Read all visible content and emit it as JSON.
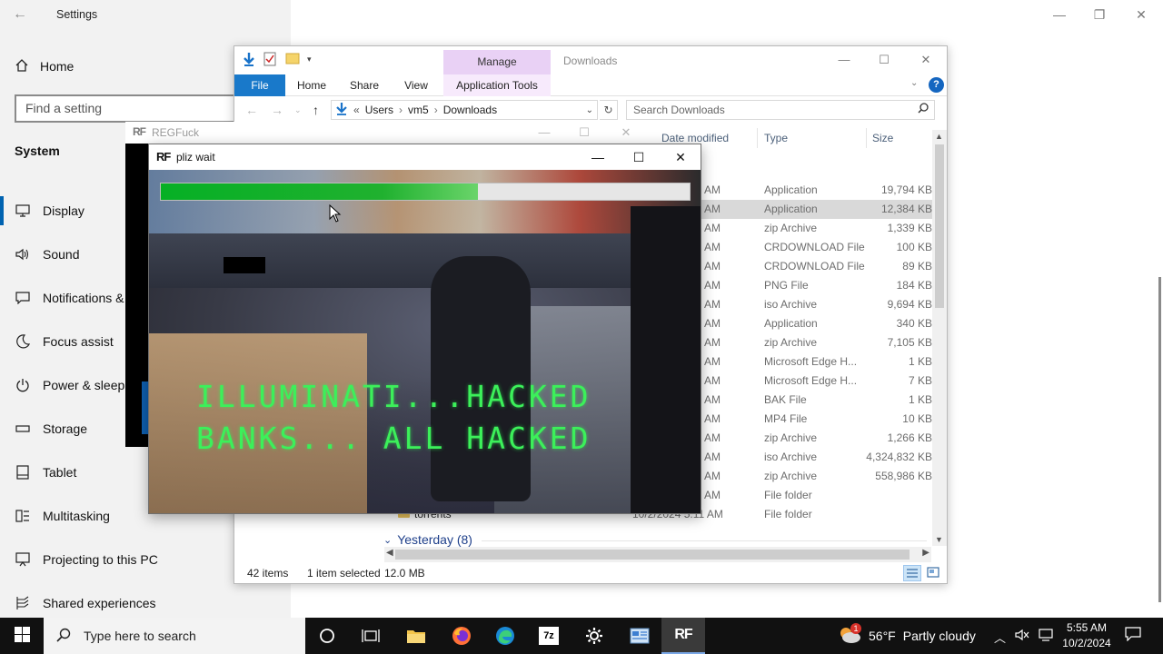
{
  "settings": {
    "title": "Settings",
    "home": "Home",
    "search_placeholder": "Find a setting",
    "section": "System",
    "nav": [
      {
        "label": "Display",
        "icon": "monitor-icon"
      },
      {
        "label": "Sound",
        "icon": "speaker-icon"
      },
      {
        "label": "Notifications & actions",
        "icon": "notifications-icon"
      },
      {
        "label": "Focus assist",
        "icon": "moon-icon"
      },
      {
        "label": "Power & sleep",
        "icon": "power-icon"
      },
      {
        "label": "Storage",
        "icon": "storage-icon"
      },
      {
        "label": "Tablet",
        "icon": "tablet-icon"
      },
      {
        "label": "Multitasking",
        "icon": "multitasking-icon"
      },
      {
        "label": "Projecting to this PC",
        "icon": "projecting-icon"
      },
      {
        "label": "Shared experiences",
        "icon": "shared-icon"
      }
    ],
    "active_nav": "Display"
  },
  "explorer": {
    "title": "Downloads",
    "manage_tab": "Manage",
    "ribbon_tabs": [
      "File",
      "Home",
      "Share",
      "View",
      "Application Tools"
    ],
    "breadcrumb": [
      "Users",
      "vm5",
      "Downloads"
    ],
    "search_placeholder": "Search Downloads",
    "columns": {
      "date": "Date modified",
      "type": "Type",
      "size": "Size"
    },
    "rows": [
      {
        "date": "AM",
        "type": "Application",
        "size": "19,794 KB",
        "selected": false
      },
      {
        "date": "AM",
        "type": "Application",
        "size": "12,384 KB",
        "selected": true
      },
      {
        "date": "AM",
        "type": "zip Archive",
        "size": "1,339 KB",
        "selected": false
      },
      {
        "date": "AM",
        "type": "CRDOWNLOAD File",
        "size": "100 KB",
        "selected": false
      },
      {
        "date": "AM",
        "type": "CRDOWNLOAD File",
        "size": "89 KB",
        "selected": false
      },
      {
        "date": "AM",
        "type": "PNG File",
        "size": "184 KB",
        "selected": false
      },
      {
        "date": "AM",
        "type": "iso Archive",
        "size": "9,694 KB",
        "selected": false
      },
      {
        "date": "AM",
        "type": "Application",
        "size": "340 KB",
        "selected": false
      },
      {
        "date": "AM",
        "type": "zip Archive",
        "size": "7,105 KB",
        "selected": false
      },
      {
        "date": "AM",
        "type": "Microsoft Edge H...",
        "size": "1 KB",
        "selected": false
      },
      {
        "date": "AM",
        "type": "Microsoft Edge H...",
        "size": "7 KB",
        "selected": false
      },
      {
        "date": "AM",
        "type": "BAK File",
        "size": "1 KB",
        "selected": false
      },
      {
        "date": "AM",
        "type": "MP4 File",
        "size": "10 KB",
        "selected": false
      },
      {
        "date": "AM",
        "type": "zip Archive",
        "size": "1,266 KB",
        "selected": false
      },
      {
        "date": "AM",
        "type": "iso Archive",
        "size": "4,324,832 KB",
        "selected": false
      },
      {
        "date": "AM",
        "type": "zip Archive",
        "size": "558,986 KB",
        "selected": false
      },
      {
        "date": "AM",
        "type": "File folder",
        "size": "",
        "selected": false
      },
      {
        "name": "torrents",
        "date": "10/2/2024 5:11 AM",
        "type": "File folder",
        "size": "",
        "selected": false
      }
    ],
    "group_yesterday": "Yesterday (8)",
    "status": {
      "items": "42 items",
      "selected": "1 item selected",
      "size": "12.0 MB"
    }
  },
  "regfuck": {
    "title": "REGFuck",
    "logo": "RF"
  },
  "pliz": {
    "title": "pliz wait",
    "logo": "RF",
    "progress": 0.6,
    "line1": "ILLUMINATI...HACKED",
    "line2": "BANKS... ALL HACKED"
  },
  "taskbar": {
    "search_placeholder": "Type here to search",
    "weather_temp": "56°F",
    "weather_desc": "Partly cloudy",
    "weather_badge": "1",
    "time": "5:55 AM",
    "date": "10/2/2024",
    "rf_logo": "RF"
  },
  "colors": {
    "accent": "#0063b1",
    "file_tab": "#1979ca",
    "manage_tab": "#e9d1f5",
    "progress_green": "#06b025",
    "hack_text": "#3cf05a",
    "taskbar": "#111111"
  }
}
